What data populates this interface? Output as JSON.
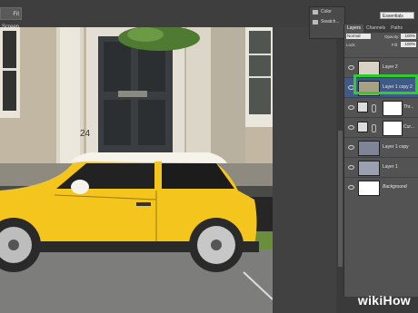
{
  "topbar": {
    "screen_mode_label": "Fit Screen",
    "workspace_label": "Essentials"
  },
  "mini_panel": {
    "items": [
      {
        "label": "Color",
        "icon": "color-icon"
      },
      {
        "label": "Swatch...",
        "icon": "swatches-icon"
      }
    ]
  },
  "layers_panel": {
    "tabs": [
      "Layers",
      "Channels",
      "Paths"
    ],
    "blend_mode": "Normal",
    "opacity_label": "Opacity:",
    "opacity_value": "100%",
    "lock_label": "Lock:",
    "fill_label": "Fill:",
    "fill_value": "100%",
    "layers": [
      {
        "name": "Layer 2",
        "type": "image"
      },
      {
        "name": "Layer 1 copy 2",
        "type": "image",
        "selected": true
      },
      {
        "name": "Thr...",
        "type": "adjustment"
      },
      {
        "name": "Cur...",
        "type": "adjustment"
      },
      {
        "name": "Layer 1 copy",
        "type": "image"
      },
      {
        "name": "Layer 1",
        "type": "image"
      },
      {
        "name": "Background",
        "type": "white"
      }
    ]
  },
  "watermark": {
    "wiki": "wiki",
    "how": "How"
  },
  "colors": {
    "accent_highlight": "#2ecc2e",
    "car_yellow": "#f3c51d",
    "panel_bg": "#535353"
  }
}
